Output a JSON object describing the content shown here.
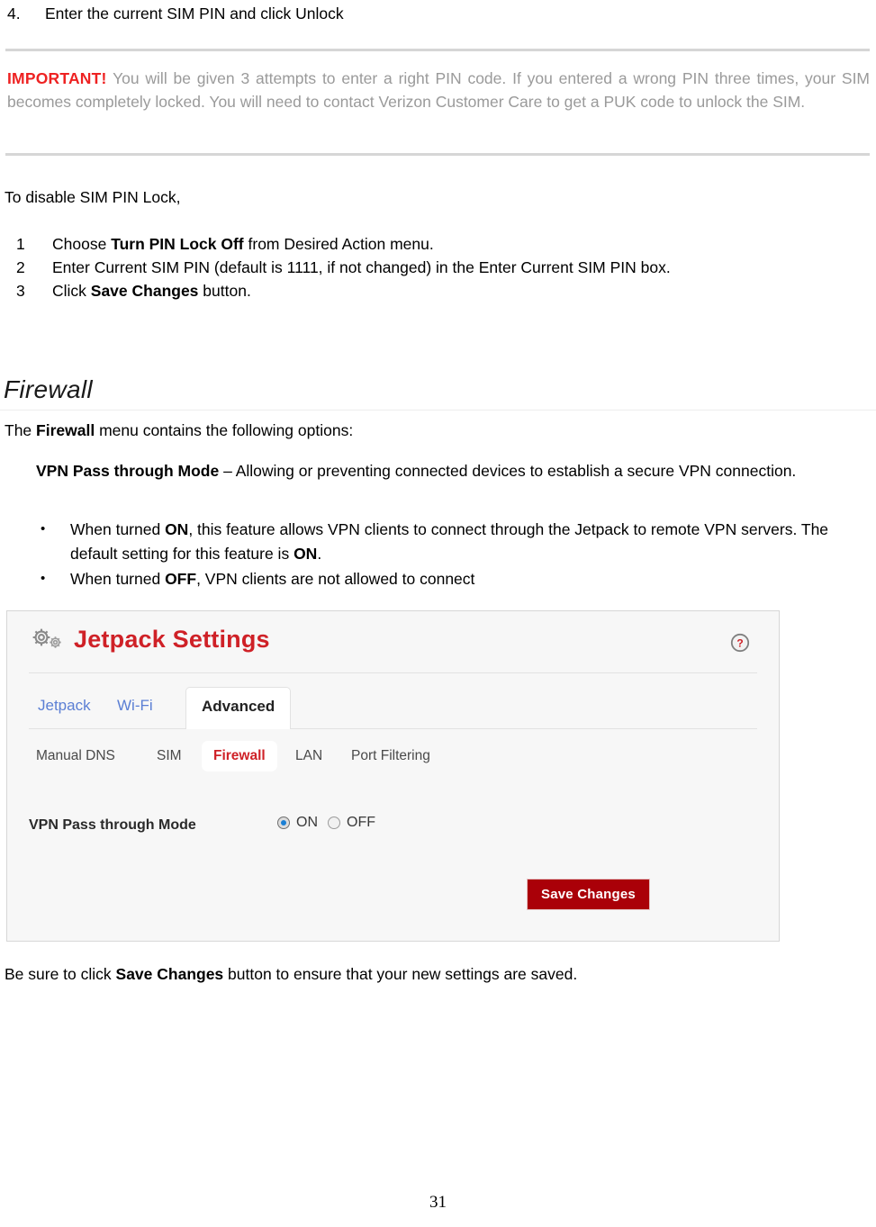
{
  "step": {
    "number": "4.",
    "text": "Enter the current SIM PIN and click Unlock"
  },
  "important_note": {
    "tag": "IMPORTANT!",
    "body": "You will be given 3 attempts to enter a right PIN code. If you entered a wrong PIN three times, your SIM becomes completely locked. You will need to contact Verizon Customer Care to get a PUK code to unlock the SIM."
  },
  "disable_section": {
    "intro": "To disable SIM PIN Lock,",
    "steps": [
      {
        "n": "1",
        "pre": "Choose ",
        "bold": "Turn PIN Lock Off",
        "post": " from Desired Action menu."
      },
      {
        "n": "2",
        "pre": "Enter Current SIM PIN (default is 1111, if not changed) in the Enter Current SIM PIN box.",
        "bold": "",
        "post": ""
      },
      {
        "n": "3",
        "pre": "Click ",
        "bold": "Save Changes",
        "post": " button."
      }
    ]
  },
  "firewall_section": {
    "heading": "Firewall",
    "intro_pre": "The ",
    "intro_bold": "Firewall",
    "intro_post": " menu contains the following options:",
    "definition_bold": "VPN Pass through Mode",
    "definition_rest": " – Allowing or preventing connected devices to establish a secure VPN connection.",
    "bullets": [
      {
        "seg1": "When turned ",
        "bold1": "ON",
        "seg2": ", this feature allows VPN clients to connect through the Jetpack to remote VPN servers. The default setting for this feature is ",
        "bold2": "ON",
        "seg3": "."
      },
      {
        "seg1": "When turned ",
        "bold1": "OFF",
        "seg2": ", VPN clients are not allowed to connect",
        "bold2": "",
        "seg3": ""
      }
    ]
  },
  "screenshot": {
    "title": "Jetpack Settings",
    "gear_icon": "gear-icon",
    "help_icon": "help-circle-icon",
    "tabs": [
      {
        "label": "Jetpack",
        "active": false
      },
      {
        "label": "Wi-Fi",
        "active": false
      },
      {
        "label": "Advanced",
        "active": true
      }
    ],
    "subtabs": [
      {
        "label": "Manual DNS",
        "active": false
      },
      {
        "label": "SIM",
        "active": false
      },
      {
        "label": "Firewall",
        "active": true
      },
      {
        "label": "LAN",
        "active": false
      },
      {
        "label": "Port Filtering",
        "active": false
      }
    ],
    "setting": {
      "label": "VPN Pass through Mode",
      "options": [
        {
          "label": "ON",
          "selected": true
        },
        {
          "label": "OFF",
          "selected": false
        }
      ]
    },
    "save_button": "Save Changes",
    "colors": {
      "brand_red": "#cf2127",
      "button_red": "#aa0008",
      "link_blue": "#5b7fd4",
      "panel_bg": "#f7f7f7",
      "radio_dot_blue": "#1b7fd4"
    }
  },
  "closing": {
    "pre": "Be sure to click ",
    "bold": "Save Changes",
    "post": " button to ensure that your new settings are saved."
  },
  "page_number": "31"
}
